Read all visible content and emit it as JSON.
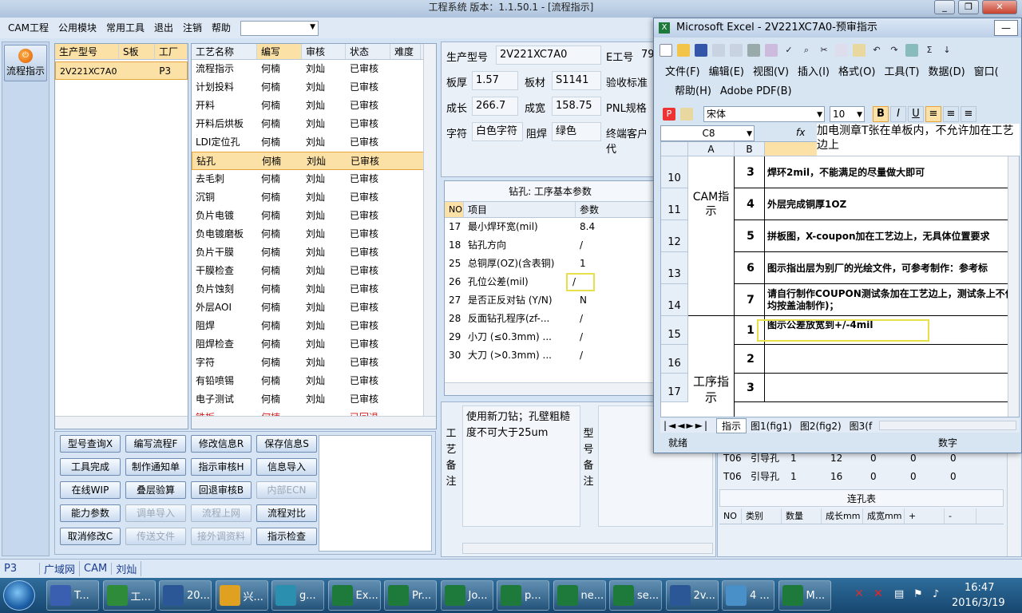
{
  "app": {
    "title": "工程系统   版本：1.1.50.1 - [流程指示]",
    "window_buttons": [
      "_",
      "❐",
      "✕"
    ],
    "menu": [
      "CAM工程",
      "公用模块",
      "常用工具",
      "退出",
      "注销",
      "帮助"
    ],
    "combo_value": ""
  },
  "leftbar": {
    "flow_button": "流程指示"
  },
  "model_grid": {
    "headers": [
      "生产型号",
      "S板",
      "工厂"
    ],
    "rows": [
      [
        "2V221XC7A0",
        "",
        "P3"
      ]
    ]
  },
  "process_grid": {
    "headers": [
      "工艺名称",
      "编写",
      "审核",
      "状态",
      "难度"
    ],
    "rows": [
      [
        "流程指示",
        "何楠",
        "刘灿",
        "已审核",
        ""
      ],
      [
        "计划投料",
        "何楠",
        "刘灿",
        "已审核",
        ""
      ],
      [
        "开料",
        "何楠",
        "刘灿",
        "已审核",
        ""
      ],
      [
        "开料后烘板",
        "何楠",
        "刘灿",
        "已审核",
        ""
      ],
      [
        "LDI定位孔",
        "何楠",
        "刘灿",
        "已审核",
        ""
      ],
      [
        "钻孔",
        "何楠",
        "刘灿",
        "已审核",
        ""
      ],
      [
        "去毛刺",
        "何楠",
        "刘灿",
        "已审核",
        ""
      ],
      [
        "沉铜",
        "何楠",
        "刘灿",
        "已审核",
        ""
      ],
      [
        "负片电镀",
        "何楠",
        "刘灿",
        "已审核",
        ""
      ],
      [
        "负电镀磨板",
        "何楠",
        "刘灿",
        "已审核",
        ""
      ],
      [
        "负片干膜",
        "何楠",
        "刘灿",
        "已审核",
        ""
      ],
      [
        "干膜检查",
        "何楠",
        "刘灿",
        "已审核",
        ""
      ],
      [
        "负片蚀刻",
        "何楠",
        "刘灿",
        "已审核",
        ""
      ],
      [
        "外层AOI",
        "何楠",
        "刘灿",
        "已审核",
        ""
      ],
      [
        "阻焊",
        "何楠",
        "刘灿",
        "已审核",
        ""
      ],
      [
        "阻焊检查",
        "何楠",
        "刘灿",
        "已审核",
        ""
      ],
      [
        "字符",
        "何楠",
        "刘灿",
        "已审核",
        ""
      ],
      [
        "有铅喷锡",
        "何楠",
        "刘灿",
        "已审核",
        ""
      ],
      [
        "电子测试",
        "何楠",
        "刘灿",
        "已审核",
        ""
      ],
      [
        "铣板",
        "何楠",
        "",
        "已回退",
        ""
      ]
    ]
  },
  "buttons": [
    [
      "型号查询X",
      "编写流程F",
      "修改信息R",
      "保存信息S"
    ],
    [
      "工具完成",
      "制作通知单",
      "指示审核H",
      "信息导入"
    ],
    [
      "在线WIP",
      "叠层验算",
      "回退审核B",
      "内部ECN"
    ],
    [
      "能力参数",
      "调单导入",
      "流程上网",
      "流程对比"
    ],
    [
      "取消修改C",
      "传送文件",
      "接外调资料",
      "指示检查"
    ]
  ],
  "info": {
    "model_label": "生产型号",
    "model_value": "2V221XC7A0",
    "eno_label": "E工号",
    "eno_value": "79",
    "thick_label": "板厚",
    "thick_value": "1.57",
    "material_label": "板材",
    "material_value": "S1141",
    "accept_label": "验收标准",
    "len_label": "成长",
    "len_value": "266.7",
    "width_label": "成宽",
    "width_value": "158.75",
    "pnl_label": "PNL规格",
    "char_label": "字符",
    "char_value": "白色字符",
    "solder_label": "阻焊",
    "solder_value": "绿色",
    "customer_label": "终端客户代"
  },
  "params": {
    "title": "钻孔: 工序基本参数",
    "headers": [
      "NO",
      "项目",
      "参数"
    ],
    "rows": [
      [
        "17",
        "最小焊环宽(mil)",
        "8.4"
      ],
      [
        "18",
        "钻孔方向",
        "/"
      ],
      [
        "25",
        "总铜厚(OZ)(含表铜)",
        "1"
      ],
      [
        "26",
        "孔位公差(mil)",
        "/"
      ],
      [
        "27",
        "是否正反对钻 (Y/N)",
        "N"
      ],
      [
        "28",
        "反面钻孔程序(zf-...",
        "/"
      ],
      [
        "29",
        "小刀 (≤0.3mm) ...",
        "/"
      ],
      [
        "30",
        "大刀 (>0.3mm) ...",
        "/"
      ]
    ]
  },
  "remark": {
    "proc_label": "工艺备注",
    "proc_text": "使用新刀钻；孔壁粗糙度不可大于25um",
    "model_label": "型号备注"
  },
  "bottom_right": {
    "rows": [
      [
        "T06",
        "引导孔",
        "1",
        "12",
        "0",
        "0",
        "0"
      ],
      [
        "T06",
        "引导孔",
        "1",
        "16",
        "0",
        "0",
        "0"
      ]
    ],
    "conn_title": "连孔表",
    "conn_headers": [
      "NO",
      "类别",
      "数量",
      "成长mm",
      "成宽mm",
      "+",
      "-"
    ]
  },
  "statusbar": [
    "P3",
    "广域网",
    "CAM",
    "刘灿"
  ],
  "excel": {
    "title": "Microsoft Excel - 2V221XC7A0-预审指示",
    "menu": [
      "文件(F)",
      "编辑(E)",
      "视图(V)",
      "插入(I)",
      "格式(O)",
      "工具(T)",
      "数据(D)",
      "窗口("
    ],
    "menu2": [
      "帮助(H)",
      "Adobe PDF(B)"
    ],
    "font_name": "宋体",
    "font_size": "10",
    "name_box": "C8",
    "fx": "fx",
    "formula": "加电测章T张在单板内，不允许加在工艺边上",
    "columns": [
      "A",
      "B",
      "C"
    ],
    "row_numbers": [
      "10",
      "11",
      "12",
      "13",
      "14",
      "15",
      "16",
      "17"
    ],
    "group_cam": "CAM指示",
    "group_proc": "工序指示",
    "cam_rows": [
      [
        "3",
        "焊环2mil，不能满足的尽量做大即可"
      ],
      [
        "4",
        "外层完成铜厚1OZ"
      ],
      [
        "5",
        "拼板图，X-coupon加在工艺边上，无具体位置要求"
      ],
      [
        "6",
        "图示指出层为别厂的光绘文件，可参考制作：参考标"
      ],
      [
        "7",
        "请自行制作COUPON测试条加在工艺边上，测试条上不位置均按盖油制作)；"
      ]
    ],
    "proc_rows": [
      [
        "1",
        "图示公差放宽到+/-4mil"
      ],
      [
        "2",
        ""
      ],
      [
        "3",
        ""
      ]
    ],
    "tabs": [
      "指示",
      "图1(fig1)",
      "图2(fig2)",
      "图3(f"
    ],
    "status_left": "就绪",
    "status_right": "数字"
  },
  "taskbar": {
    "items": [
      "T...",
      "工...",
      "20...",
      "兴...",
      "g...",
      "Ex...",
      "Pr...",
      "Jo...",
      "p...",
      "ne...",
      "se...",
      "2v...",
      "4 ...",
      "M..."
    ],
    "time": "16:47",
    "date": "2016/3/19"
  },
  "colors": {
    "accent_orange": "#e7a43c",
    "highlight_yellow": "#e8e04a",
    "returned_red": "#d61b1b"
  }
}
